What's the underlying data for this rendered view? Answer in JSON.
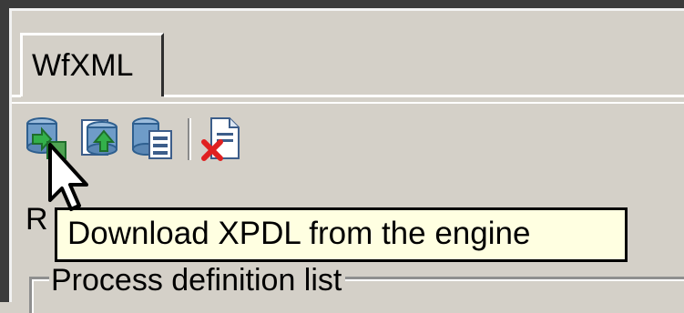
{
  "tabs": [
    {
      "label": "WfXML",
      "selected": true
    }
  ],
  "toolbar": {
    "buttons": [
      {
        "icon": "download-xpdl-icon",
        "tooltip": "Download XPDL from the engine"
      },
      {
        "icon": "upload-xpdl-icon"
      },
      {
        "icon": "process-list-icon"
      },
      {
        "icon": "delete-document-icon"
      }
    ]
  },
  "tooltip": {
    "text": "Download XPDL from the engine"
  },
  "partial_label": "R",
  "groupbox": {
    "title": "Process definition list"
  },
  "colors": {
    "window_bg": "#d4d0c8",
    "tooltip_bg": "#ffffe1",
    "frame_dark": "#3b3b3b"
  }
}
